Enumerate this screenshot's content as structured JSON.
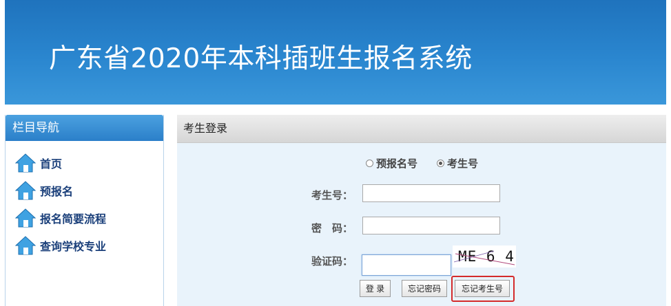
{
  "header": {
    "title": "广东省2020年本科插班生报名系统"
  },
  "sidebar": {
    "title": "栏目导航",
    "items": [
      {
        "label": "首页",
        "icon": "home-icon"
      },
      {
        "label": "预报名",
        "icon": "home-icon"
      },
      {
        "label": "报名简要流程",
        "icon": "home-icon"
      },
      {
        "label": "查询学校专业",
        "icon": "home-icon"
      }
    ]
  },
  "login": {
    "title": "考生登录",
    "radio_options": [
      {
        "label": "预报名号",
        "checked": false
      },
      {
        "label": "考生号",
        "checked": true
      }
    ],
    "fields": {
      "candidate_label": "考生号：",
      "candidate_value": "",
      "password_label": "密　码：",
      "password_value": "",
      "captcha_label": "验证码：",
      "captcha_value": ""
    },
    "captcha_text": "ME 6 4",
    "buttons": {
      "login": "登 录",
      "forgot_password": "忘记密码",
      "forgot_candidate_no": "忘记考生号"
    }
  },
  "colors": {
    "banner": "#2a86cf",
    "highlight": "#d42a2a",
    "nav_text": "#1a3f7a"
  }
}
